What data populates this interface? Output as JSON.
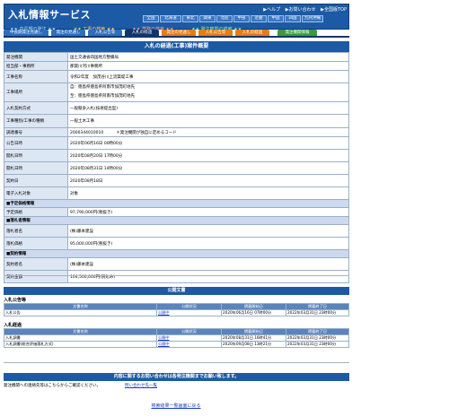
{
  "header": {
    "title": "入札情報サービス",
    "top_links": [
      "▶ヘルプ",
      "▶お問い合わせ",
      "▶全国版TOP"
    ],
    "regions": [
      "全国",
      "北海道",
      "東北",
      "関東",
      "北陸",
      "中部",
      "近畿",
      "中国",
      "四国",
      "九州沖縄"
    ]
  },
  "sections": {
    "a": "★★ 中長期の発注 ★★",
    "b": "★★ 工事の検索 ★★",
    "c": "★★ 業務の検索 ★★",
    "d": "★★ 発注機関の検索 ★★"
  },
  "tabs": [
    "中長期発注見通し",
    "発注の見通し",
    "入札公告等",
    "入札の経過",
    "発注の見通し",
    "入札公告等",
    "入札の経過",
    "発注機関情報"
  ],
  "page_title": "入札の経過(工事)案件概要",
  "rows": [
    {
      "label": "発注機関",
      "value": "国土交通省四国地方整備局"
    },
    {
      "label": "担当部・事務所",
      "value": "那賀川河川事務所"
    },
    {
      "label": "工事名称",
      "value": "令和2年度　加茂谷川上流築堤工事"
    },
    {
      "label": "工事場所",
      "value1": "自：徳島県徳島県阿南市加茂町地先",
      "value2": "至：徳島県徳島県阿南市加茂町地先"
    },
    {
      "label": "入札契約方式",
      "value": "一般競争入札(技術提出型)"
    },
    {
      "label": "工事種別/工事の種類",
      "value": "一般土木工事"
    },
    {
      "label": "調達番号",
      "value": "2000344010010",
      "note": "＊発注機関が独自に定めるコード"
    },
    {
      "label": "公告日時",
      "value": "2020年06月16日 00時00分"
    },
    {
      "label": "開札日時",
      "value": "2020年08月20日 17時00分"
    },
    {
      "label": "開札日時",
      "value": "2020年08月31日 14時00分"
    },
    {
      "label": "契約日",
      "value": "2020年08月18日"
    },
    {
      "label": "電子入札対象",
      "value": "対象"
    }
  ],
  "groups": {
    "estimate": "■予定価格情報",
    "estimate_label": "予定価格",
    "estimate_value": "97,790,000円(税抜き)",
    "winner": "■落札者情報",
    "winner_name_label": "落札者名",
    "winner_name": "(株)藤本建設",
    "winner_price_label": "落札価格",
    "winner_price": "95,000,000円(税抜き)",
    "contract": "■契約情報",
    "contractor_label": "契約者名",
    "contractor": "(株)藤本建設",
    "contract_amount_label": "契約金額",
    "contract_amount": "104,500,000円(税込み)"
  },
  "public_docs": {
    "title": "公開文書",
    "section1": "入札公告等",
    "section2": "入札経過",
    "headers": [
      "文書名称",
      "公開状況",
      "掲載開始日",
      "掲載終了日"
    ],
    "docs1": [
      {
        "name": "入札公告",
        "status": "公開中",
        "start": "2020年06月16日 07時00分",
        "end": "2022年03月31日 23時00分"
      }
    ],
    "docs2": [
      {
        "name": "入札調書",
        "status": "公開中",
        "start": "2020年08月31日 16時41分",
        "end": "2022年03月31日 23時00分"
      },
      {
        "name": "入札調書(総合評価落札方式)",
        "status": "公開中",
        "start": "2020年09月08日 13時21分",
        "end": "2022年03月31日 23時00分"
      }
    ]
  },
  "contact": {
    "title": "内容に関するお問い合わせは各発注機関までお願い致します。",
    "left": "発注機関への連絡先等はこちらからご確認ください。",
    "link": "問い合わせ先一覧"
  },
  "back_link": "検索結果一覧画面に戻る"
}
